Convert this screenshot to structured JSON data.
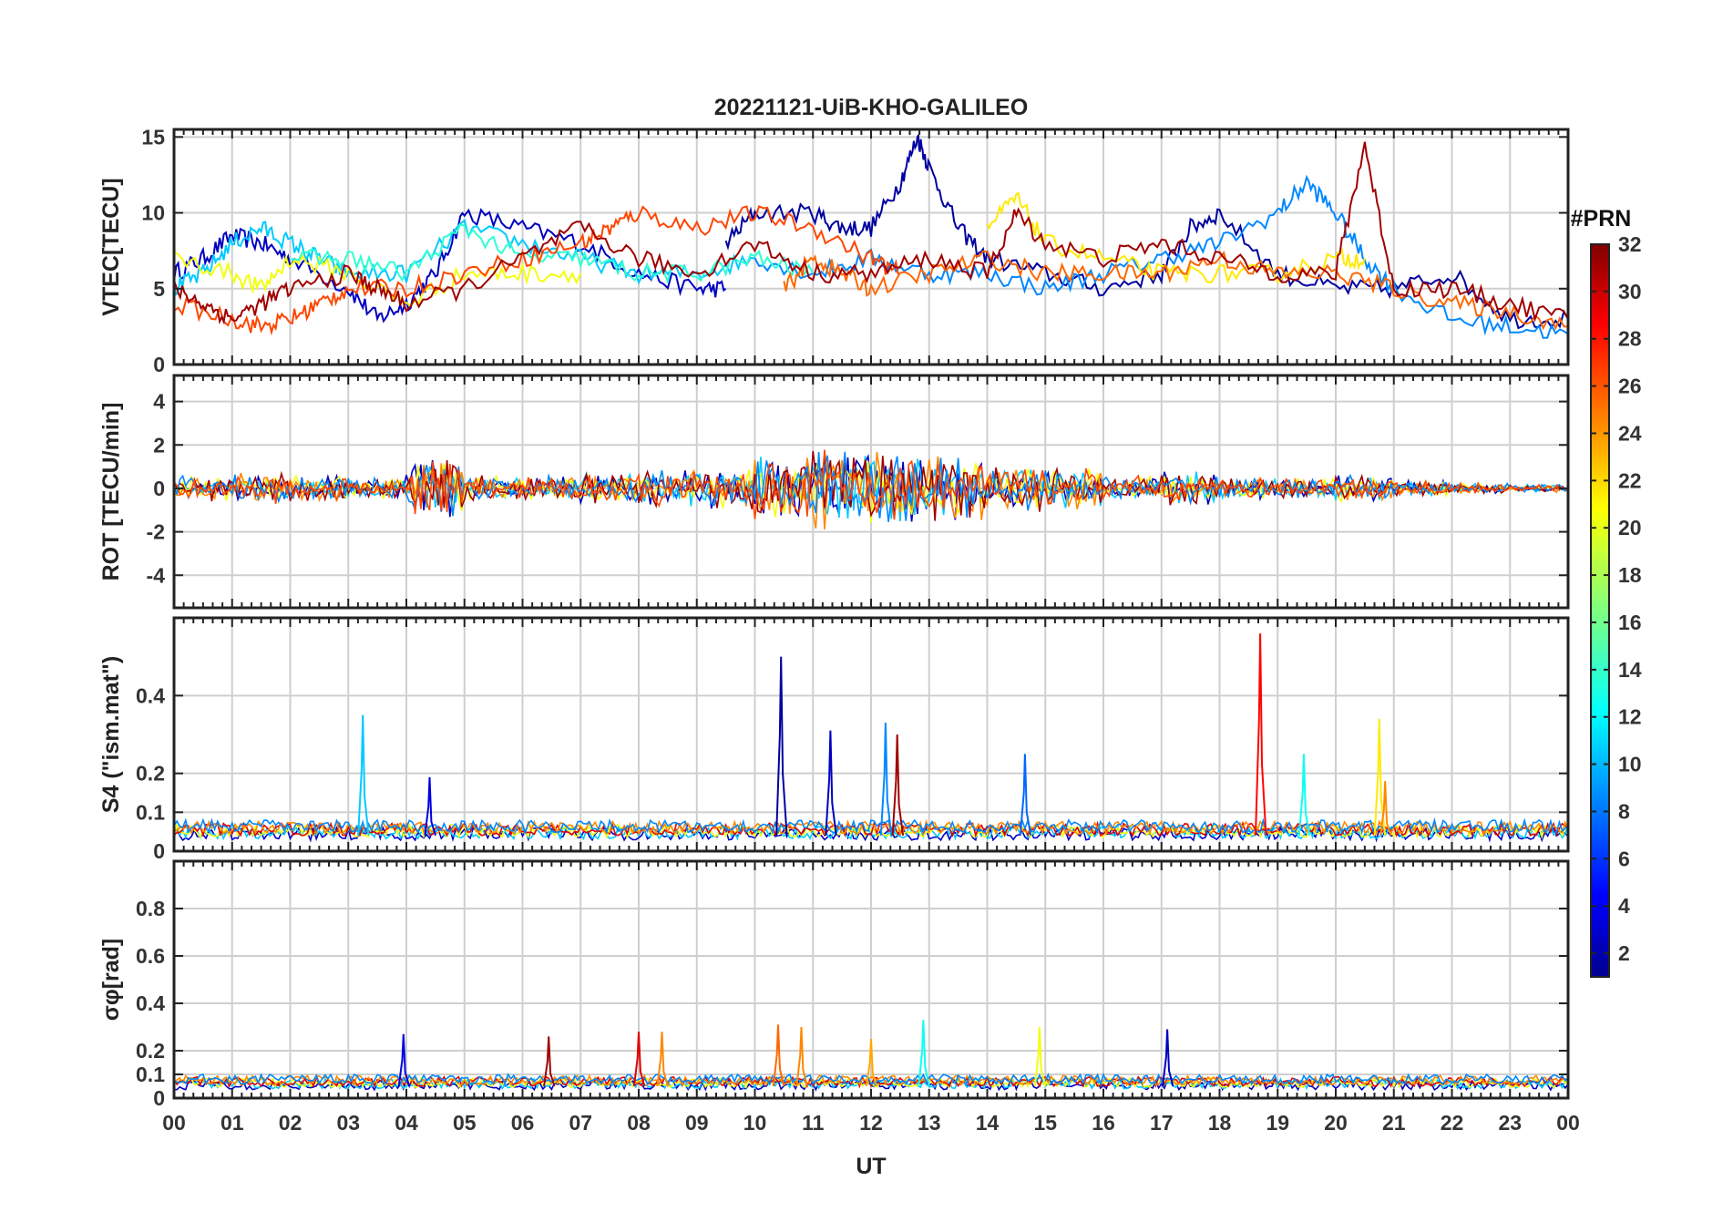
{
  "chart_data": {
    "type": "line",
    "title": "20221121-UiB-KHO-GALILEO",
    "xlabel": "UT",
    "x_ticks": [
      "00",
      "01",
      "02",
      "03",
      "04",
      "05",
      "06",
      "07",
      "08",
      "09",
      "10",
      "11",
      "12",
      "13",
      "14",
      "15",
      "16",
      "17",
      "18",
      "19",
      "20",
      "21",
      "22",
      "23",
      "00"
    ],
    "xlim": [
      0,
      24
    ],
    "grid": true,
    "colorbar": {
      "label": "#PRN",
      "range": [
        1,
        32
      ],
      "ticks": [
        2,
        4,
        6,
        8,
        10,
        12,
        14,
        16,
        18,
        20,
        22,
        24,
        26,
        28,
        30,
        32
      ],
      "colormap": "jet"
    },
    "panels": [
      {
        "ylabel": "VTEC[TECU]",
        "ylim": [
          0,
          15.5
        ],
        "yticks": [
          0,
          5,
          10,
          15
        ],
        "series": [
          {
            "prn": 3,
            "x": [
              0,
              0.5,
              1,
              1.5,
              2,
              3,
              3.5,
              4,
              4.5,
              5,
              6,
              7,
              8,
              9,
              9.5
            ],
            "y": [
              6,
              7,
              8.5,
              8,
              7,
              5,
              3,
              4,
              6,
              10,
              9,
              8,
              6,
              5,
              5
            ]
          },
          {
            "prn": 2,
            "x": [
              9.5,
              10,
              11,
              11.5,
              12,
              12.5,
              12.8,
              13,
              13.5,
              14,
              15,
              16,
              17,
              17.5,
              18,
              19,
              20,
              21,
              22,
              23,
              24
            ],
            "y": [
              8,
              10,
              10,
              9,
              9,
              12,
              15,
              13,
              9,
              7,
              6,
              5,
              6,
              9,
              10,
              6,
              5,
              5,
              6,
              3,
              3
            ]
          },
          {
            "prn": 11,
            "x": [
              0,
              0.5,
              1,
              1.5,
              2,
              2.5,
              3,
              4,
              5,
              6,
              7,
              8,
              9,
              10
            ],
            "y": [
              5,
              6,
              8,
              9,
              8,
              7,
              6,
              6,
              9,
              8,
              7,
              6,
              6,
              7
            ]
          },
          {
            "prn": 9,
            "x": [
              10,
              11,
              12,
              13,
              14,
              15,
              16,
              17,
              18,
              19,
              19.5,
              20,
              20.5,
              21,
              22,
              23,
              24
            ],
            "y": [
              7,
              6,
              7,
              6,
              6,
              5,
              6,
              7,
              8,
              10,
              12,
              10,
              7,
              5,
              3,
              2.5,
              2
            ]
          },
          {
            "prn": 20,
            "x": [
              0,
              1,
              1.5,
              2,
              3,
              4,
              5,
              6,
              7
            ],
            "y": [
              7,
              6,
              5,
              7,
              6,
              4,
              6,
              6,
              6
            ]
          },
          {
            "prn": 21,
            "x": [
              14,
              14.5,
              15,
              16,
              17,
              18,
              19,
              20,
              20.5
            ],
            "y": [
              9,
              11,
              8,
              7,
              6,
              6,
              6,
              7,
              7
            ]
          },
          {
            "prn": 14,
            "x": [
              2,
              3,
              4,
              5,
              6,
              7,
              8,
              9,
              10,
              11
            ],
            "y": [
              7,
              7,
              6,
              9,
              7,
              7,
              6,
              6,
              7,
              6
            ]
          },
          {
            "prn": 26,
            "x": [
              0,
              1,
              1.5,
              2,
              2.5,
              3,
              4,
              5,
              6,
              7,
              7.5,
              8,
              9,
              10,
              11,
              12,
              12.5
            ],
            "y": [
              4,
              3,
              2.5,
              3,
              4,
              5,
              5,
              6,
              7,
              8,
              9,
              10,
              9,
              10,
              9,
              7,
              6
            ]
          },
          {
            "prn": 25,
            "x": [
              10.5,
              11,
              11.5,
              12,
              13,
              14,
              15,
              16,
              17,
              18,
              19,
              20,
              21,
              22,
              23,
              24
            ],
            "y": [
              5,
              7,
              6,
              5,
              6,
              7,
              6,
              6,
              6,
              7,
              6,
              6,
              5,
              4,
              3.5,
              2.5
            ]
          },
          {
            "prn": 31,
            "x": [
              0,
              0.5,
              1,
              1.5,
              2,
              3,
              3.5,
              4,
              5,
              6,
              7,
              8,
              9,
              10,
              11,
              12,
              13,
              14,
              14.5,
              15,
              16,
              17,
              18,
              19,
              20,
              20.5,
              21,
              22,
              23,
              24
            ],
            "y": [
              5,
              4,
              3,
              4,
              5,
              6,
              5,
              4,
              5,
              7,
              9,
              7,
              6,
              8,
              6,
              6,
              7,
              6,
              10,
              8,
              7,
              8,
              7,
              6,
              6,
              14.5,
              5,
              5,
              4,
              3
            ]
          }
        ]
      },
      {
        "ylabel": "ROT [TECU/min]",
        "ylim": [
          -5.5,
          5.2
        ],
        "yticks": [
          -4,
          -2,
          0,
          2,
          4
        ],
        "note_amplitude": [
          1.0,
          1.2,
          1.0,
          0.8,
          2.5,
          1.0,
          1.0,
          1.2,
          1.4,
          1.6,
          2.5,
          3.2,
          2.8,
          2.5,
          1.8,
          1.6,
          1.0,
          1.4,
          0.8,
          0.8,
          1.0,
          0.6,
          0.4,
          0.3,
          0.3
        ]
      },
      {
        "ylabel": "S4 (\"ism.mat\")",
        "ylim": [
          0,
          0.6
        ],
        "yticks": [
          0,
          0.1,
          0.2,
          0.4
        ],
        "peaks": [
          {
            "prn": 11,
            "x": 3.25,
            "y": 0.35
          },
          {
            "prn": 4,
            "x": 4.4,
            "y": 0.19
          },
          {
            "prn": 2,
            "x": 10.45,
            "y": 0.5
          },
          {
            "prn": 3,
            "x": 11.3,
            "y": 0.31
          },
          {
            "prn": 9,
            "x": 12.25,
            "y": 0.33
          },
          {
            "prn": 31,
            "x": 12.45,
            "y": 0.3
          },
          {
            "prn": 8,
            "x": 14.65,
            "y": 0.25
          },
          {
            "prn": 28,
            "x": 18.7,
            "y": 0.56
          },
          {
            "prn": 13,
            "x": 19.45,
            "y": 0.25
          },
          {
            "prn": 21,
            "x": 20.75,
            "y": 0.34
          },
          {
            "prn": 24,
            "x": 20.85,
            "y": 0.18
          }
        ]
      },
      {
        "ylabel": "σφ[rad]",
        "ylim": [
          0,
          1.0
        ],
        "yticks": [
          0,
          0.1,
          0.2,
          0.4,
          0.6,
          0.8
        ],
        "peaks": [
          {
            "prn": 4,
            "x": 3.95,
            "y": 0.27
          },
          {
            "prn": 31,
            "x": 6.45,
            "y": 0.26
          },
          {
            "prn": 29,
            "x": 8.0,
            "y": 0.28
          },
          {
            "prn": 24,
            "x": 8.4,
            "y": 0.28
          },
          {
            "prn": 25,
            "x": 10.4,
            "y": 0.31
          },
          {
            "prn": 24,
            "x": 10.8,
            "y": 0.3
          },
          {
            "prn": 23,
            "x": 12.0,
            "y": 0.25
          },
          {
            "prn": 13,
            "x": 12.9,
            "y": 0.33
          },
          {
            "prn": 20,
            "x": 14.9,
            "y": 0.3
          },
          {
            "prn": 3,
            "x": 17.1,
            "y": 0.29
          }
        ]
      }
    ]
  }
}
